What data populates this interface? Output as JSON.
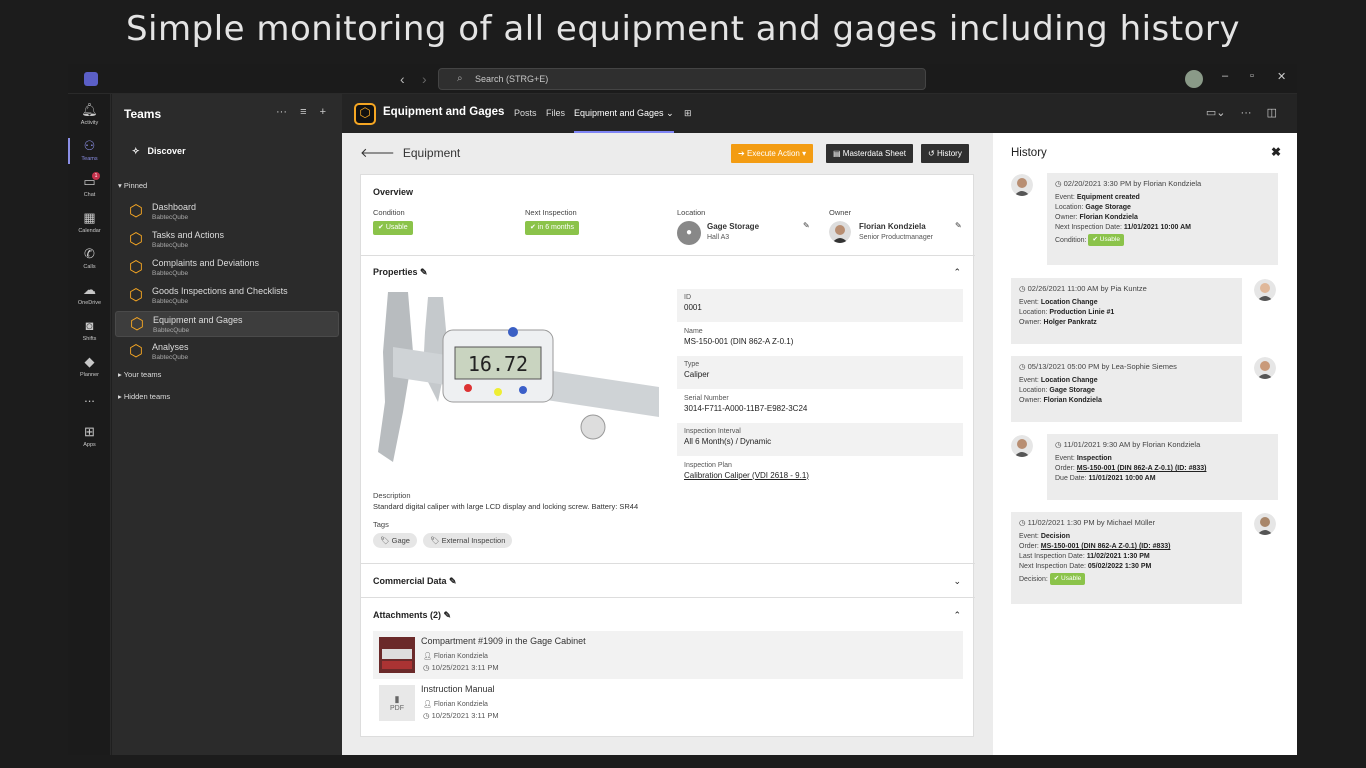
{
  "headline": "Simple monitoring of all equipment and gages including history",
  "titlebar": {
    "search_placeholder": "Search (STRG+E)",
    "back_icon": "chevron-left-icon",
    "forward_icon": "chevron-right-icon"
  },
  "rail": [
    {
      "label": "Activity",
      "icon": "bell-icon"
    },
    {
      "label": "Teams",
      "icon": "teams-icon",
      "active": true
    },
    {
      "label": "Chat",
      "icon": "chat-icon",
      "badge": "1"
    },
    {
      "label": "Calendar",
      "icon": "calendar-icon"
    },
    {
      "label": "Calls",
      "icon": "phone-icon"
    },
    {
      "label": "OneDrive",
      "icon": "cloud-icon"
    },
    {
      "label": "Shifts",
      "icon": "shifts-icon"
    },
    {
      "label": "Planner",
      "icon": "planner-icon"
    },
    {
      "label": "...",
      "icon": "more-icon"
    },
    {
      "label": "Apps",
      "icon": "apps-icon"
    }
  ],
  "teams": {
    "title": "Teams",
    "discover": "Discover",
    "pinned": "Pinned",
    "items": [
      {
        "name": "Dashboard",
        "sub": "BabtecQube"
      },
      {
        "name": "Tasks and Actions",
        "sub": "BabtecQube"
      },
      {
        "name": "Complaints and Deviations",
        "sub": "BabtecQube"
      },
      {
        "name": "Goods Inspections and Checklists",
        "sub": "BabtecQube"
      },
      {
        "name": "Equipment and Gages",
        "sub": "BabtecQube",
        "active": true
      },
      {
        "name": "Analyses",
        "sub": "BabtecQube"
      }
    ],
    "your_teams": "Your teams",
    "hidden_teams": "Hidden teams"
  },
  "channel": {
    "title": "Equipment and Gages",
    "tabs": [
      "Posts",
      "Files",
      "Equipment and Gages"
    ],
    "active_tab": 2
  },
  "equipment": {
    "heading": "Equipment",
    "execute_action": "Execute Action",
    "masterdata_sheet": "Masterdata Sheet",
    "history": "History",
    "overview": {
      "title": "Overview",
      "condition_label": "Condition",
      "condition_value": "Usable",
      "next_inspection_label": "Next Inspection",
      "next_inspection_value": "in 6 months",
      "location_label": "Location",
      "location_name": "Gage Storage",
      "location_sub": "Hall A3",
      "owner_label": "Owner",
      "owner_name": "Florian Kondziela",
      "owner_role": "Senior Productmanager"
    },
    "properties": {
      "title": "Properties",
      "fields": [
        {
          "label": "ID",
          "value": "0001"
        },
        {
          "label": "Name",
          "value": "MS-150-001 (DIN 862-A Z-0.1)"
        },
        {
          "label": "Type",
          "value": "Caliper"
        },
        {
          "label": "Serial Number",
          "value": "3014-F711-A000-11B7-E982-3C24"
        },
        {
          "label": "Inspection Interval",
          "value": "All 6 Month(s) / Dynamic"
        },
        {
          "label": "Inspection Plan",
          "value": "Calibration Caliper (VDI 2618 - 9.1)",
          "link": true
        }
      ],
      "caliper_display": "16.72",
      "description_label": "Description",
      "description": "Standard digital caliper with large LCD display and locking screw. Battery: SR44",
      "tags_label": "Tags",
      "tags": [
        "Gage",
        "External Inspection"
      ]
    },
    "commercial_data": "Commercial Data",
    "attachments": {
      "title": "Attachments (2)",
      "items": [
        {
          "title": "Compartment #1909 in the Gage Cabinet",
          "author": "Florian Kondziela",
          "date": "10/25/2021 3:11 PM"
        },
        {
          "title": "Instruction Manual",
          "author": "Florian Kondziela",
          "date": "10/25/2021 3:11 PM",
          "type": "PDF"
        }
      ]
    }
  },
  "history": {
    "title": "History",
    "entries": [
      {
        "head": "02/20/2021 3:30 PM by Florian Kondziela",
        "lines": [
          [
            "Event:",
            "Equipment created"
          ],
          [
            "Location:",
            "Gage Storage"
          ],
          [
            "Owner:",
            "Florian Kondziela"
          ],
          [
            "Next Inspection Date:",
            "11/01/2021 10:00 AM"
          ]
        ],
        "condition": "Usable"
      },
      {
        "head": "02/26/2021 11:00 AM by Pia Kuntze",
        "lines": [
          [
            "Event:",
            "Location Change"
          ],
          [
            "Location:",
            "Production Linie #1"
          ],
          [
            "Owner:",
            "Holger Pankratz"
          ]
        ]
      },
      {
        "head": "05/13/2021 05:00 PM by Lea-Sophie Siemes",
        "lines": [
          [
            "Event:",
            "Location Change"
          ],
          [
            "Location:",
            "Gage Storage"
          ],
          [
            "Owner:",
            "Florian Kondziela"
          ]
        ]
      },
      {
        "head": "11/01/2021 9:30 AM by Florian Kondziela",
        "lines": [
          [
            "Event:",
            "Inspection"
          ],
          [
            "Order:",
            "MS-150-001 (DIN 862-A Z-0.1) (ID: #833)"
          ],
          [
            "Due Date:",
            "11/01/2021 10:00 AM"
          ]
        ]
      },
      {
        "head": "11/02/2021 1:30 PM by Michael Müller",
        "lines": [
          [
            "Event:",
            "Decision"
          ],
          [
            "Order:",
            "MS-150-001 (DIN 862-A Z-0.1) (ID: #833)"
          ],
          [
            "Last Inspection Date:",
            "11/02/2021 1:30 PM"
          ],
          [
            "Next Inspection Date:",
            "05/02/2022 1:30 PM"
          ]
        ],
        "decision": "Usable"
      }
    ],
    "condition_label": "Condition:",
    "decision_label": "Decision:"
  },
  "colors": {
    "accent": "#f39c12",
    "teams_purple": "#8b8fe6",
    "usable": "#8bc34a"
  }
}
